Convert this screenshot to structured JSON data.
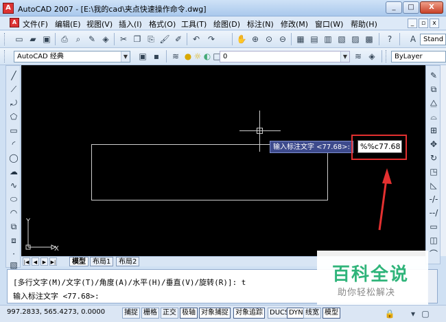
{
  "window": {
    "title": "AutoCAD 2007 - [E:\\我的cad\\夹点快速操作命令.dwg]",
    "minimize": "_",
    "restore": "□",
    "close": "X"
  },
  "menubar": {
    "items": [
      "文件(F)",
      "编辑(E)",
      "视图(V)",
      "插入(I)",
      "格式(O)",
      "工具(T)",
      "绘图(D)",
      "标注(N)",
      "修改(M)",
      "窗口(W)",
      "帮助(H)"
    ],
    "doc_min": "_",
    "doc_restore": "▫",
    "doc_close": "x"
  },
  "toolbar1": {
    "text_style": "Stand"
  },
  "toolbar2": {
    "workspace": "AutoCAD 经典",
    "layer": "0",
    "color": "ByLayer"
  },
  "canvas": {
    "tooltip": "输入标注文字 <77.68>:",
    "input_value": "%%c77.68",
    "ucs_x": "X",
    "ucs_y": "Y"
  },
  "tabs": [
    "模型",
    "布局1",
    "布局2"
  ],
  "command": {
    "line1": "[多行文字(M)/文字(T)/角度(A)/水平(H)/垂直(V)/旋转(R)]: t",
    "line2": "输入标注文字 <77.68>:"
  },
  "status": {
    "coords": "997.2833,  565.4273, 0.0000",
    "buttons": [
      "捕捉",
      "栅格",
      "正交",
      "极轴",
      "对象捕捉",
      "对象追踪",
      "DUCS",
      "DYN",
      "线宽",
      "模型"
    ]
  },
  "watermark": {
    "title": "百科全说",
    "subtitle": "助你轻松解决"
  },
  "colors": {
    "canvas": "#000000",
    "highlight": "#e33030",
    "tooltip_bg": "#3d4a8c"
  }
}
